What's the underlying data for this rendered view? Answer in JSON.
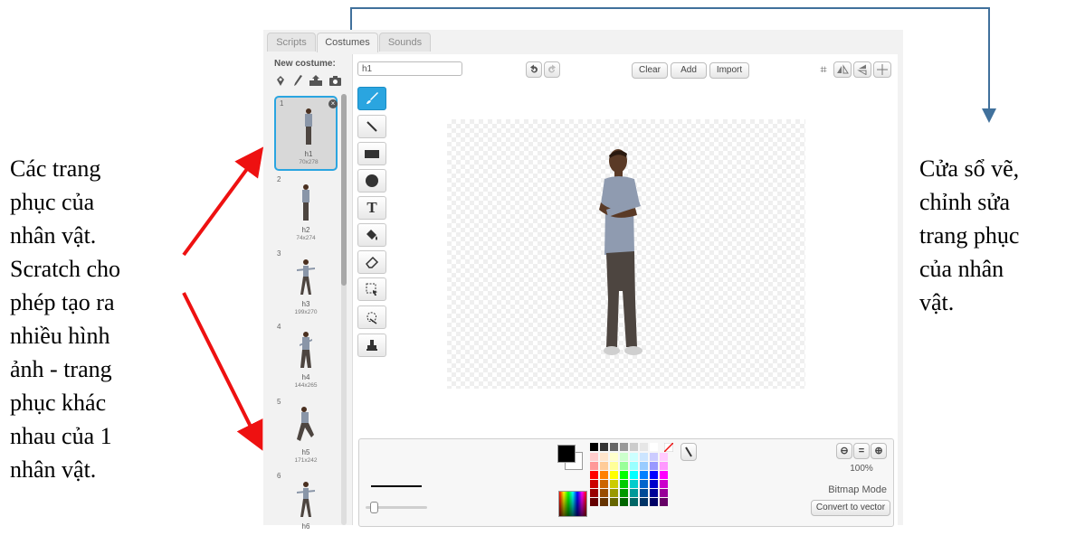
{
  "annotations": {
    "left_text": "Các trang\nphục của\nnhân vật.\nScratch cho\nphép tạo ra\nnhiều hình\nảnh - trang\nphục khác\nnhau của 1\nnhân vật.",
    "right_text": "Cửa sổ vẽ,\nchỉnh sửa\ntrang phục\ncủa nhân\nvật."
  },
  "tabs": [
    {
      "label": "Scripts",
      "active": false
    },
    {
      "label": "Costumes",
      "active": true
    },
    {
      "label": "Sounds",
      "active": false
    }
  ],
  "sidebar": {
    "new_costume_label": "New costume:",
    "icons": [
      "paint-new-icon",
      "brush-icon",
      "upload-icon",
      "camera-icon"
    ],
    "costumes": [
      {
        "number": "1",
        "name": "h1",
        "size": "70x278",
        "selected": true
      },
      {
        "number": "2",
        "name": "h2",
        "size": "74x274",
        "selected": false
      },
      {
        "number": "3",
        "name": "h3",
        "size": "199x270",
        "selected": false
      },
      {
        "number": "4",
        "name": "h4",
        "size": "144x265",
        "selected": false
      },
      {
        "number": "5",
        "name": "h5",
        "size": "171x242",
        "selected": false
      },
      {
        "number": "6",
        "name": "h6",
        "size": "",
        "selected": false
      }
    ]
  },
  "editor": {
    "costume_name_value": "h1",
    "clear_label": "Clear",
    "add_label": "Add",
    "import_label": "Import",
    "zoom_level": "100%",
    "mode_label": "Bitmap Mode",
    "convert_label": "Convert to vector",
    "tools": [
      "brush-tool-icon",
      "line-tool-icon",
      "rectangle-tool-icon",
      "ellipse-tool-icon",
      "text-tool-icon",
      "fill-tool-icon",
      "eraser-tool-icon",
      "select-tool-icon",
      "magic-select-tool-icon",
      "stamp-tool-icon"
    ],
    "accent_color": "#2aa5e0"
  },
  "palette": {
    "row0": [
      "#000000",
      "#333333",
      "#666666",
      "#999999",
      "#cccccc",
      "#e6e6e6",
      "#ffffff"
    ],
    "rows": [
      [
        "#ffcccc",
        "#ffe5cc",
        "#ffffcc",
        "#ccffcc",
        "#ccffff",
        "#cce5ff",
        "#ccccff",
        "#ffccff"
      ],
      [
        "#ff9999",
        "#ffcc99",
        "#ffff99",
        "#99ff99",
        "#99ffff",
        "#99ccff",
        "#9999ff",
        "#ff99ff"
      ],
      [
        "#ff0000",
        "#ff8000",
        "#ffff00",
        "#00ff00",
        "#00ffff",
        "#0080ff",
        "#0000ff",
        "#ff00ff"
      ],
      [
        "#cc0000",
        "#cc6600",
        "#cccc00",
        "#00cc00",
        "#00cccc",
        "#0066cc",
        "#0000cc",
        "#cc00cc"
      ],
      [
        "#990000",
        "#994c00",
        "#999900",
        "#009900",
        "#009999",
        "#004c99",
        "#000099",
        "#990099"
      ],
      [
        "#660000",
        "#663300",
        "#666600",
        "#006600",
        "#006666",
        "#003366",
        "#000066",
        "#660066"
      ]
    ]
  }
}
